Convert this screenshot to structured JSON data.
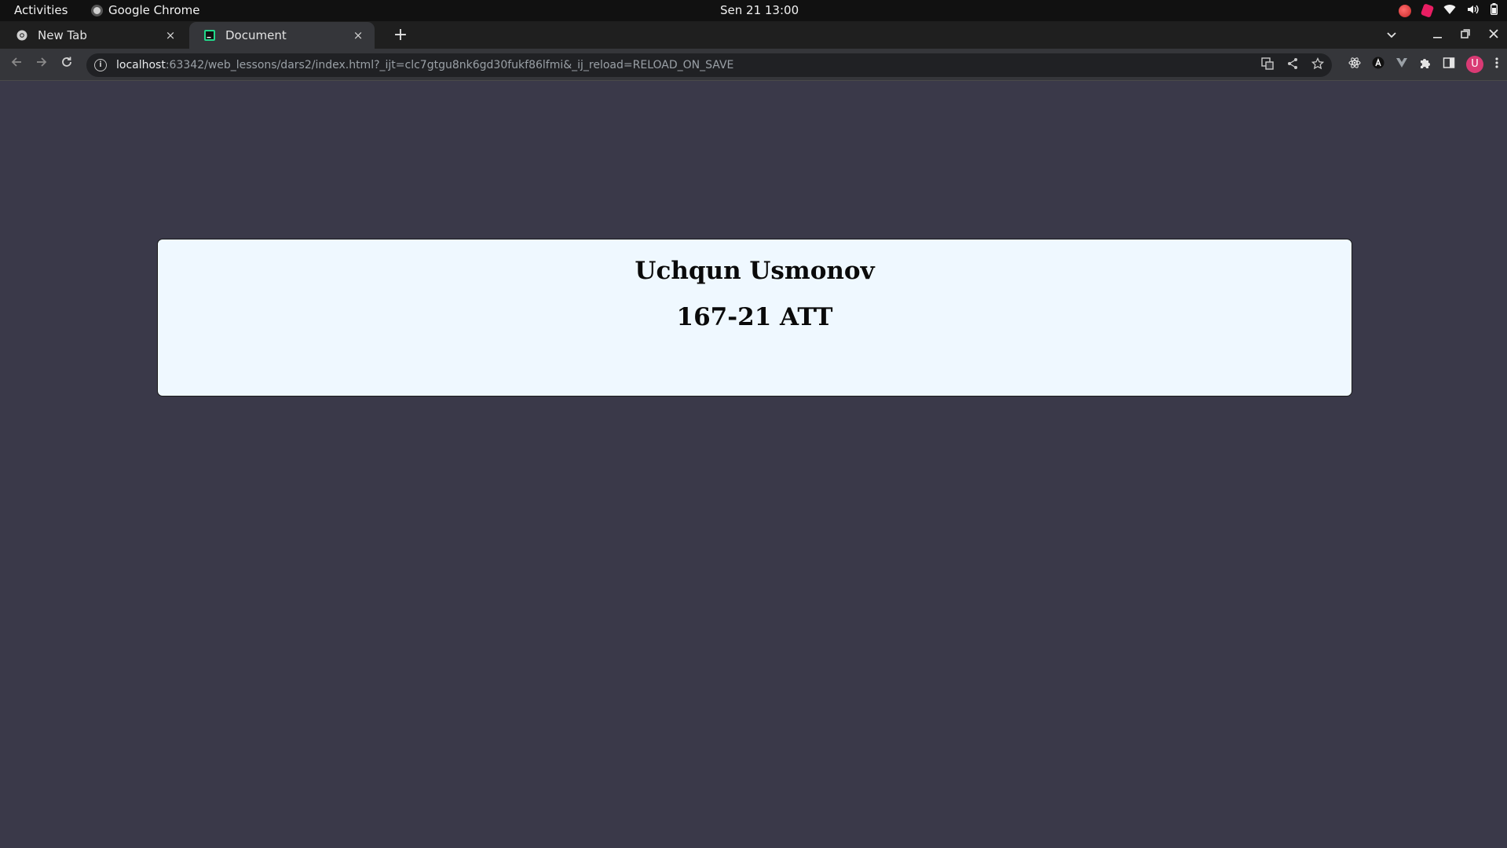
{
  "system_bar": {
    "activities": "Activities",
    "app_name": "Google Chrome",
    "clock": "Sen 21  13:00"
  },
  "tabs": [
    {
      "title": "New Tab",
      "active": false,
      "close": "×"
    },
    {
      "title": "Document",
      "active": true,
      "close": "×"
    }
  ],
  "new_tab_label": "+",
  "address_bar": {
    "host": "localhost",
    "rest": ":63342/web_lessons/dars2/index.html?_ijt=clc7gtgu8nk6gd30fukf86lfmi&_ij_reload=RELOAD_ON_SAVE"
  },
  "profile_initial": "U",
  "colors": {
    "page_background": "#3a3949",
    "card_background": "#eff8ff",
    "avatar": "#d93a74"
  },
  "page": {
    "name": "Uchqun Usmonov",
    "group": "167-21 ATT"
  }
}
